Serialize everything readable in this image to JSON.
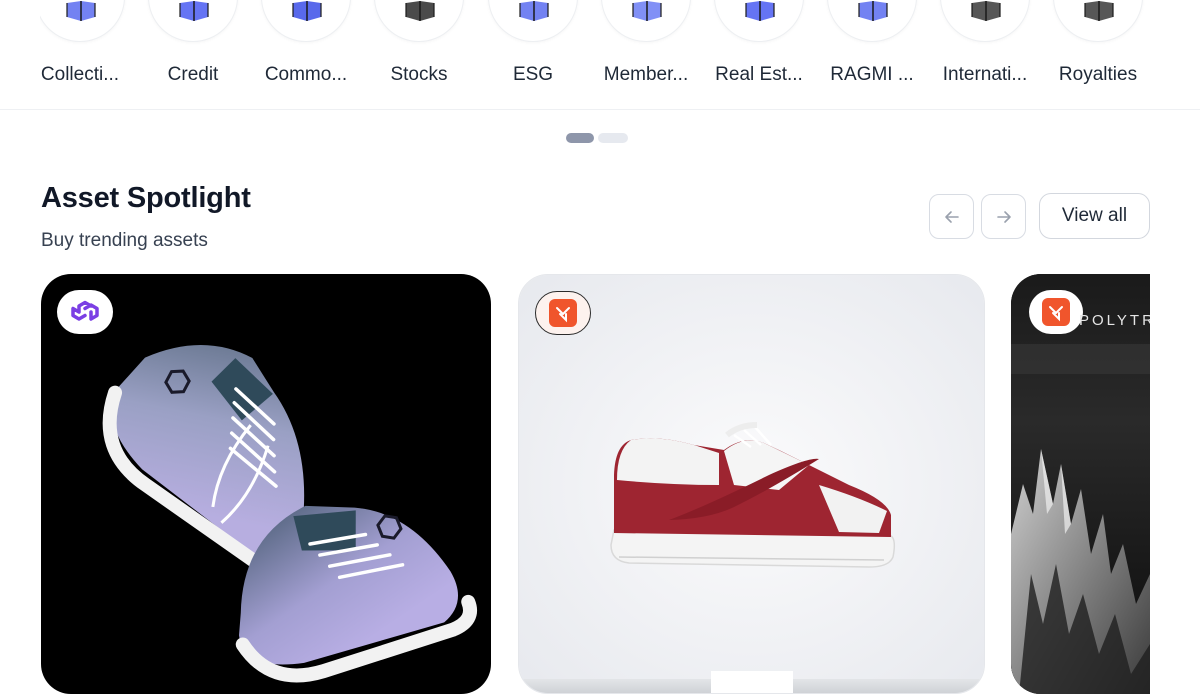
{
  "categories": [
    {
      "label": "Collecti...",
      "icon": "collectibles-icon"
    },
    {
      "label": "Credit",
      "icon": "credit-icon"
    },
    {
      "label": "Commo...",
      "icon": "commodities-icon"
    },
    {
      "label": "Stocks",
      "icon": "stocks-icon"
    },
    {
      "label": "ESG",
      "icon": "esg-icon"
    },
    {
      "label": "Member...",
      "icon": "memberships-icon"
    },
    {
      "label": "Real Est...",
      "icon": "real-estate-icon"
    },
    {
      "label": "RAGMI ...",
      "icon": "ragmi-icon"
    },
    {
      "label": "Internati...",
      "icon": "international-icon"
    },
    {
      "label": "Royalties",
      "icon": "royalties-icon"
    }
  ],
  "carousel": {
    "active_page": 1,
    "total_pages": 2
  },
  "section": {
    "title": "Asset Spotlight",
    "subtitle": "Buy trending assets",
    "view_all_label": "View all",
    "prev_icon": "arrow-left-icon",
    "next_icon": "arrow-right-icon"
  },
  "cards": [
    {
      "chain_icon": "polygon-icon",
      "image": "purple-gradient-sneakers",
      "accent": "#7b3fe4"
    },
    {
      "chain_icon": "orange-chain-icon",
      "image": "red-white-sneaker",
      "accent": "#f0552c"
    },
    {
      "chain_icon": "orange-chain-icon",
      "brand_text": "POLYTR",
      "image": "dark-crystal-landscape",
      "accent": "#f0552c"
    }
  ],
  "colors": {
    "accent_purple": "#7b3fe4",
    "accent_orange": "#f0552c",
    "text_primary": "#111827",
    "border": "#d8dce3"
  }
}
